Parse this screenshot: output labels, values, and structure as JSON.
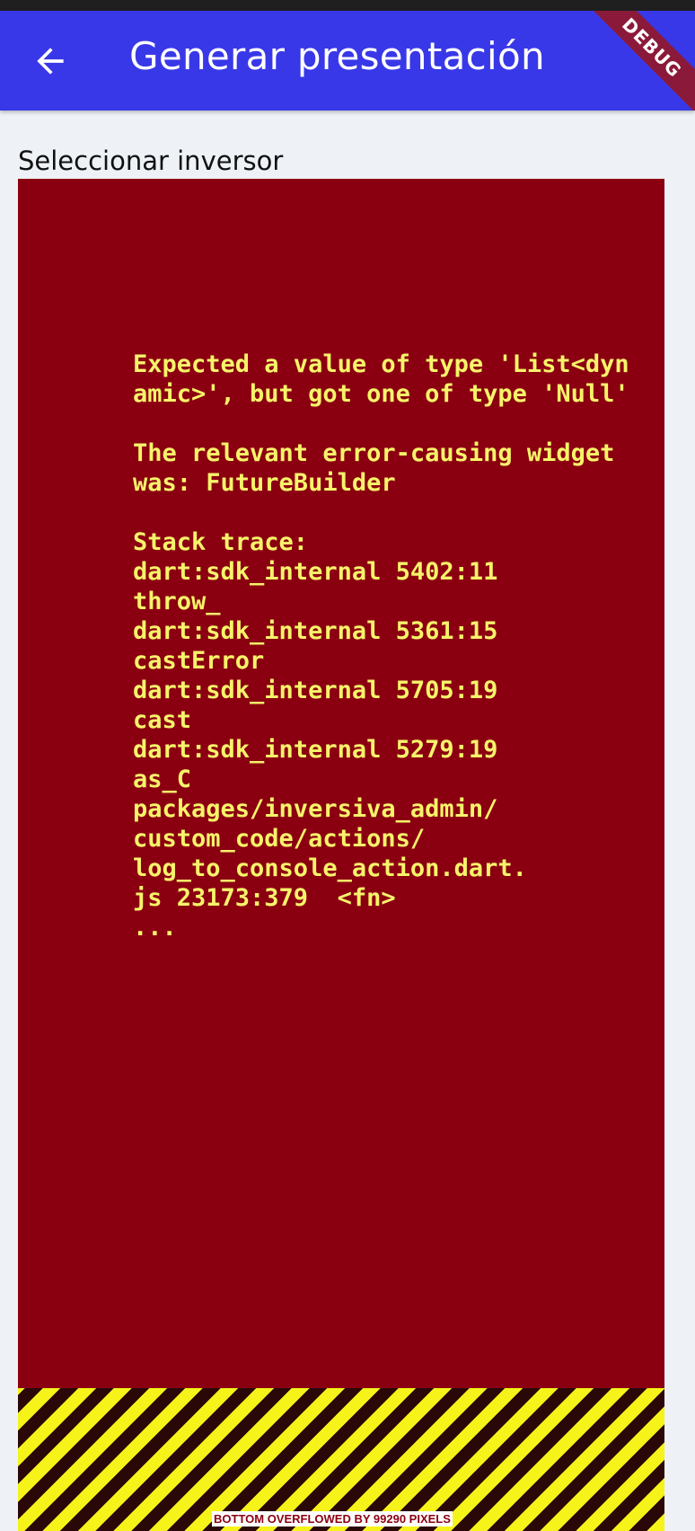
{
  "app_bar": {
    "title": "Generar presentación",
    "back_icon": "arrow-left-icon",
    "background_color": "#3838E8",
    "debug_banner": "DEBUG",
    "debug_banner_color": "#8B1A3A"
  },
  "form": {
    "section_label": "Seleccionar inversor"
  },
  "error": {
    "background_color": "#8B0011",
    "text_color": "#F6F36A",
    "message": "Expected a value of type 'List<dynamic>', but got one of type 'Null'\n\nThe relevant error-causing widget was: FutureBuilder\n\nStack trace:\ndart:sdk_internal 5402:11\nthrow_\ndart:sdk_internal 5361:15\ncastError\ndart:sdk_internal 5705:19\ncast\ndart:sdk_internal 5279:19\nas_C\npackages/inversiva_admin/\ncustom_code/actions/\nlog_to_console_action.dart.\njs 23173:379  <fn>\n..."
  },
  "overflow": {
    "label": "BOTTOM OVERFLOWED BY 99290 PIXELS",
    "stripe_colors": [
      "#F6F31A",
      "#2a0808"
    ]
  }
}
